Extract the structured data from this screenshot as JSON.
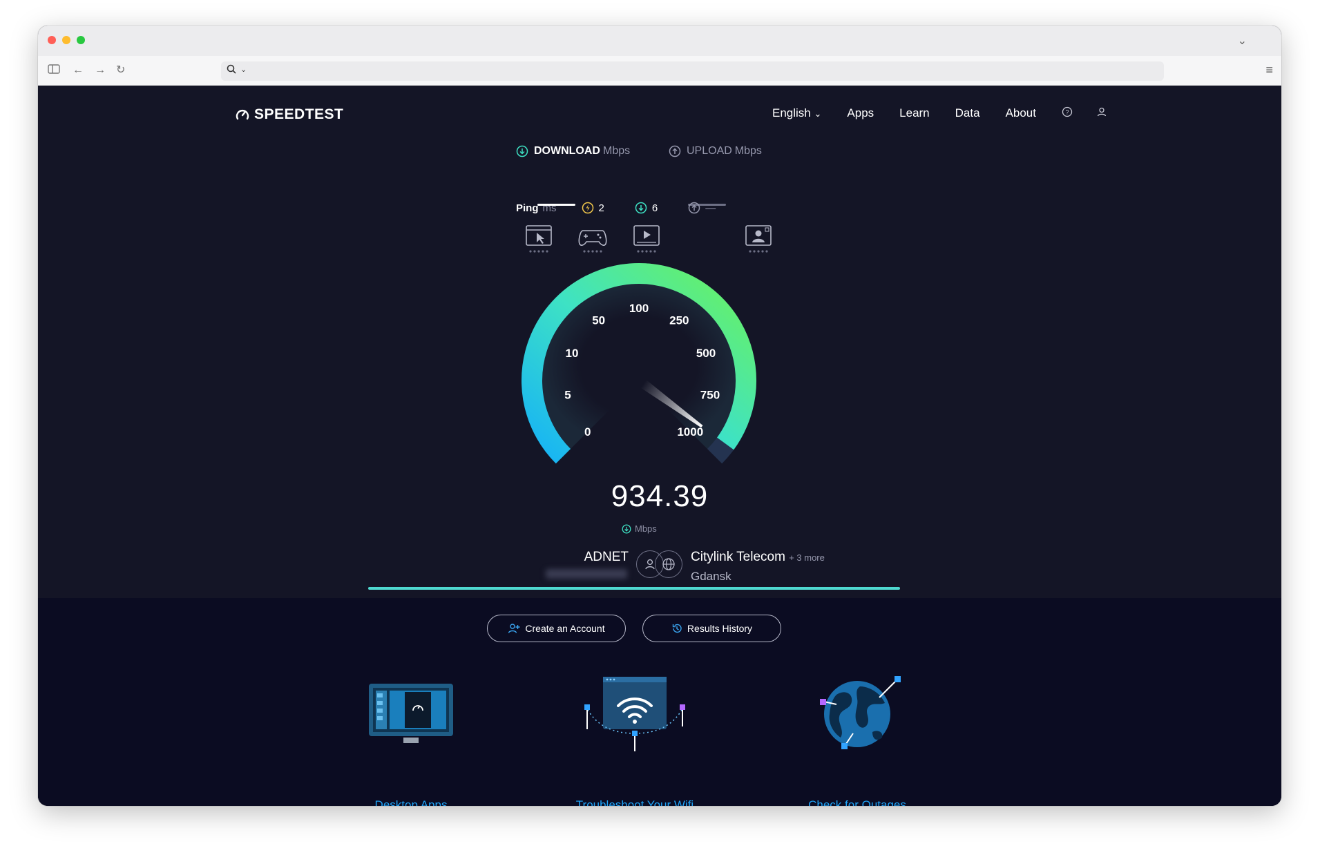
{
  "browser": {
    "address_text": ""
  },
  "header": {
    "logo_text": "SPEEDTEST",
    "nav": {
      "language": "English",
      "apps": "Apps",
      "learn": "Learn",
      "data": "Data",
      "about": "About"
    }
  },
  "tabs": {
    "download": {
      "label": "DOWNLOAD",
      "unit": "Mbps"
    },
    "upload": {
      "label": "UPLOAD",
      "unit": "Mbps"
    }
  },
  "ping": {
    "label": "Ping",
    "unit": "ms",
    "idle": "2",
    "download": "6",
    "upload": "—"
  },
  "gauge": {
    "ticks": [
      "0",
      "5",
      "10",
      "50",
      "100",
      "250",
      "500",
      "750",
      "1000"
    ],
    "speed_value": "934.39",
    "speed_unit": "Mbps",
    "colors": {
      "start": "#16b2f6",
      "mid": "#3ee2c4",
      "end": "#6cf25c"
    }
  },
  "connection": {
    "isp": "ADNET",
    "server_name": "Citylink Telecom",
    "server_more": "+ 3 more",
    "server_city": "Gdansk"
  },
  "progress": {
    "fraction": 1.0,
    "color": "#4fd8d0"
  },
  "actions": {
    "create_account": "Create an Account",
    "results_history": "Results History"
  },
  "features": {
    "desktop_apps": "Desktop Apps",
    "troubleshoot_wifi": "Troubleshoot Your Wifi",
    "check_outages": "Check for Outages"
  }
}
